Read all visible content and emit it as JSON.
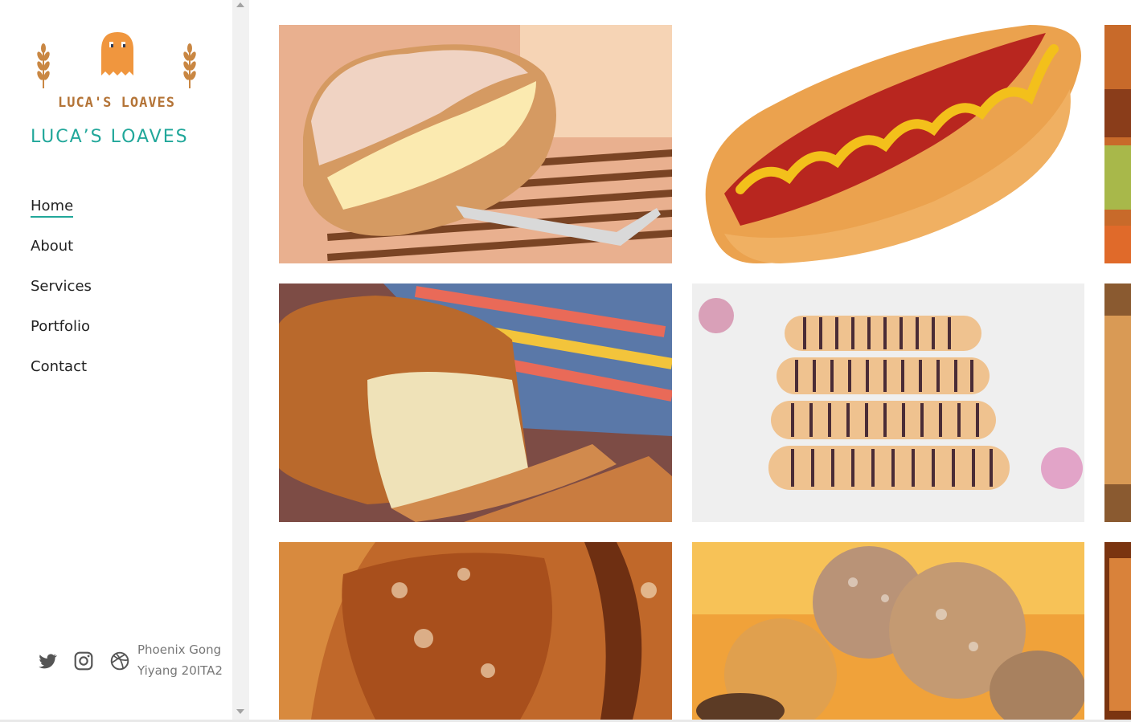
{
  "brand": {
    "logo_text": "LUCA'S LOAVES",
    "site_title": "LUCA’S LOAVES",
    "accent_color": "#21a79a",
    "logo_color": "#b47437"
  },
  "nav": {
    "items": [
      {
        "label": "Home",
        "active": true
      },
      {
        "label": "About",
        "active": false
      },
      {
        "label": "Services",
        "active": false
      },
      {
        "label": "Portfolio",
        "active": false
      },
      {
        "label": "Contact",
        "active": false
      }
    ]
  },
  "footer": {
    "social": [
      {
        "icon": "twitter-icon"
      },
      {
        "icon": "instagram-icon"
      },
      {
        "icon": "dribbble-icon"
      }
    ],
    "credit_line1": "Phoenix Gong",
    "credit_line2": "Yiyang 20ITA2"
  },
  "gallery": {
    "items": [
      {
        "subject": "cream-filled-coconut-bun"
      },
      {
        "subject": "hot-dog-bun"
      },
      {
        "subject": "partial-image"
      },
      {
        "subject": "sliced-bread-loaf"
      },
      {
        "subject": "striped-chocolate-rolls"
      },
      {
        "subject": "partial-image"
      },
      {
        "subject": "rustic-crusty-bread"
      },
      {
        "subject": "assorted-round-breads"
      },
      {
        "subject": "partial-image"
      }
    ]
  }
}
